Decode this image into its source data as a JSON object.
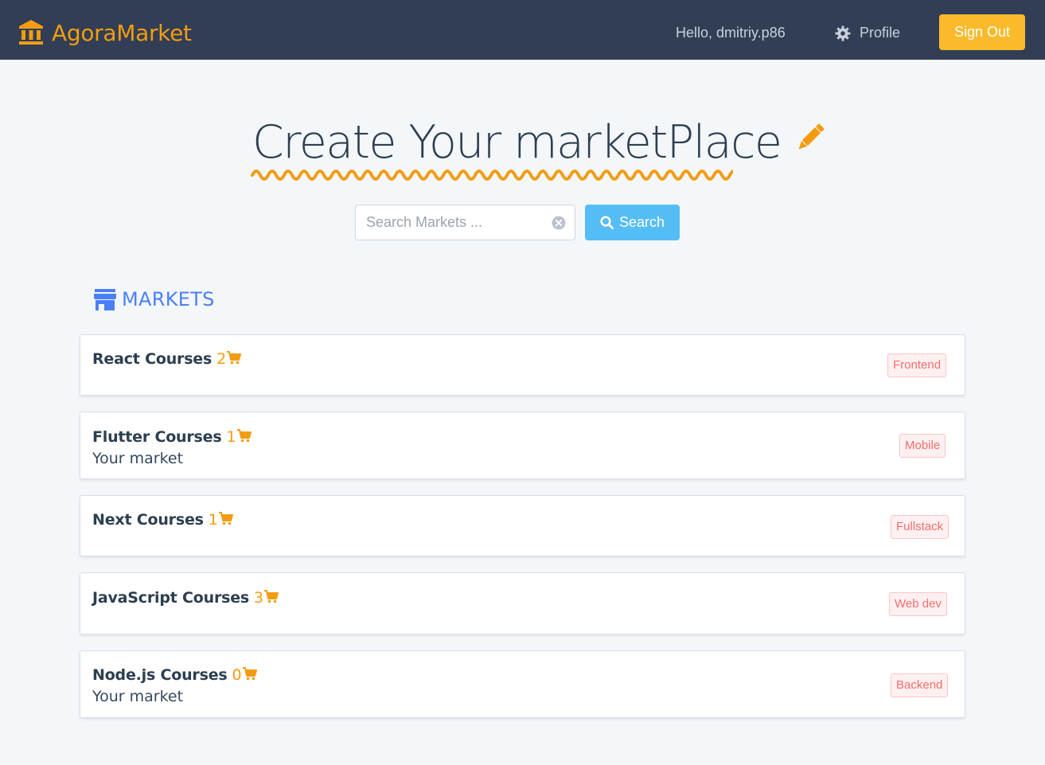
{
  "navbar": {
    "brand": "AgoraMarket",
    "greeting": "Hello, dmitriy.p86",
    "profile_label": "Profile",
    "signout_label": "Sign Out",
    "icons": {
      "brand": "bank-icon",
      "profile": "gear-icon"
    }
  },
  "hero": {
    "title": "Create Your marketPlace",
    "icon": "pencil-icon"
  },
  "search": {
    "placeholder": "Search Markets ...",
    "value": "",
    "button_label": "Search",
    "icons": {
      "clear": "clear-circle-icon",
      "button": "search-icon"
    }
  },
  "markets": {
    "heading": "MARKETS",
    "icon": "store-icon",
    "items": [
      {
        "name": "React Courses",
        "count": "2",
        "subtitle": "",
        "tag": "Frontend"
      },
      {
        "name": "Flutter Courses",
        "count": "1",
        "subtitle": "Your market",
        "tag": "Mobile"
      },
      {
        "name": "Next Courses",
        "count": "1",
        "subtitle": "",
        "tag": "Fullstack"
      },
      {
        "name": "JavaScript Courses",
        "count": "3",
        "subtitle": "",
        "tag": "Web dev"
      },
      {
        "name": "Node.js Courses",
        "count": "0",
        "subtitle": "Your market",
        "tag": "Backend"
      }
    ]
  },
  "colors": {
    "navbar": "#313e55",
    "brand": "#f39c12",
    "signout": "#fbba2c",
    "search_button": "#55bdf5",
    "markets_heading": "#4a80f5",
    "tag_text": "#f56c6c",
    "tag_bg": "#fef0f0"
  }
}
